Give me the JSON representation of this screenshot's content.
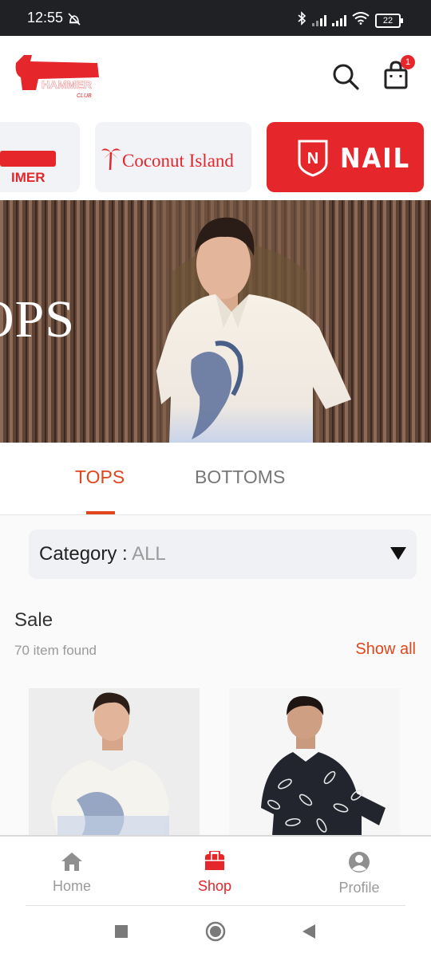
{
  "status_bar": {
    "time": "12:55",
    "battery": "22"
  },
  "header": {
    "logo_text": "HAMMER",
    "logo_subtext": "CLUB",
    "cart_badge": "1"
  },
  "brands": [
    {
      "label": "IMER"
    },
    {
      "label": "Coconut Island"
    },
    {
      "label": "NAIL"
    }
  ],
  "banner": {
    "title": "OPS"
  },
  "tabs": [
    {
      "label": "TOPS",
      "active": true
    },
    {
      "label": "BOTTOMS",
      "active": false
    }
  ],
  "category": {
    "label": "Category : ",
    "value": "ALL"
  },
  "sale": {
    "title": "Sale",
    "count": "70 item found",
    "show_all": "Show all"
  },
  "bottom_nav": [
    {
      "label": "Home",
      "icon": "home-icon",
      "active": false
    },
    {
      "label": "Shop",
      "icon": "shop-icon",
      "active": true
    },
    {
      "label": "Profile",
      "icon": "profile-icon",
      "active": false
    }
  ],
  "colors": {
    "brand_red": "#e5262b",
    "accent_orange": "#e0461b",
    "inactive_gray": "#9a9a9a"
  }
}
